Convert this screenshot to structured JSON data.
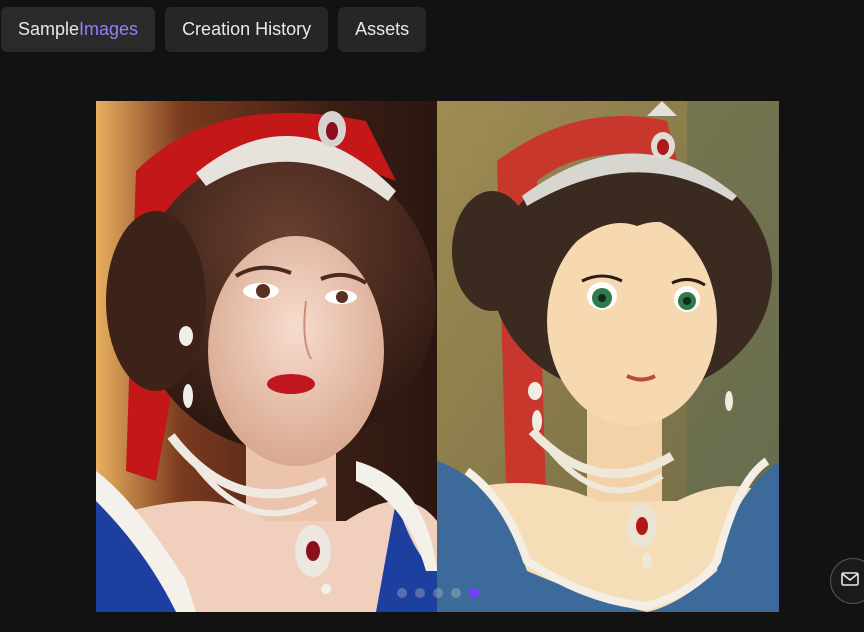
{
  "tabs": [
    {
      "label_main": "Sample ",
      "label_accent": "Images",
      "active": true
    },
    {
      "label_main": "Creation History",
      "label_accent": ""
    },
    {
      "label_main": "Assets",
      "label_accent": ""
    }
  ],
  "carousel": {
    "slide_count": 5,
    "active_index": 4
  },
  "colors": {
    "accent": "#9a7bff",
    "active_dot": "#7a3cff",
    "background": "#121212",
    "tab_bg": "#262626"
  },
  "icons": {
    "mail": "mail-icon"
  }
}
